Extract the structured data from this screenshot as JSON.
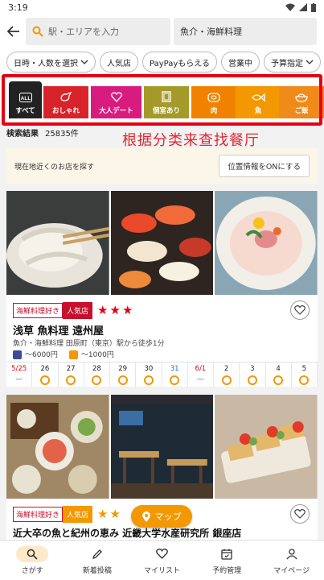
{
  "status": {
    "time": "3:19"
  },
  "search": {
    "area_placeholder": "駅・エリアを入力",
    "genre_value": "魚介・海鮮料理"
  },
  "filters": [
    {
      "label": "日時・人数を選択",
      "dropdown": true
    },
    {
      "label": "人気店",
      "dropdown": false
    },
    {
      "label": "PayPayもらえる",
      "dropdown": false
    },
    {
      "label": "営業中",
      "dropdown": false
    },
    {
      "label": "予算指定",
      "dropdown": true
    }
  ],
  "categories": [
    {
      "label": "すべて",
      "icon": "all-icon",
      "color": "#222222"
    },
    {
      "label": "おしゃれ",
      "icon": "bird-icon",
      "color": "#d8232a"
    },
    {
      "label": "大人デート",
      "icon": "heart-icon",
      "color": "#d81b7f"
    },
    {
      "label": "個室あり",
      "icon": "door-icon",
      "color": "#a49a2a"
    },
    {
      "label": "肉",
      "icon": "meat-icon",
      "color": "#f08200"
    },
    {
      "label": "魚",
      "icon": "fish-icon",
      "color": "#f39800"
    },
    {
      "label": "ご飯",
      "icon": "rice-bowl-icon",
      "color": "#f08a1b"
    }
  ],
  "results": {
    "label": "検索結果",
    "count": "25835件"
  },
  "annotation": "根据分类来查找餐厅",
  "location": {
    "text": "現在地近くのお店を探す",
    "button": "位置情報をONにする"
  },
  "restaurants": [
    {
      "badge_genre": "海鮮料理好き",
      "badge_popular": "人気店",
      "stars": 3,
      "name": "浅草 魚料理 遠州屋",
      "info": "魚介・海鮮料理 田原町（東京）駅から徒歩1分",
      "dinner_price": "～6000円",
      "lunch_price": "～1000円",
      "calendar": [
        {
          "date": "5/25",
          "avail": "dash",
          "color": "#e60012"
        },
        {
          "date": "26",
          "avail": "ring",
          "color": "#222222"
        },
        {
          "date": "27",
          "avail": "ring",
          "color": "#222222"
        },
        {
          "date": "28",
          "avail": "ring",
          "color": "#222222"
        },
        {
          "date": "29",
          "avail": "ring",
          "color": "#222222"
        },
        {
          "date": "30",
          "avail": "ring",
          "color": "#222222"
        },
        {
          "date": "31",
          "avail": "ring",
          "color": "#1e6fd9"
        },
        {
          "date": "6/1",
          "avail": "dash",
          "color": "#e60012"
        },
        {
          "date": "2",
          "avail": "ring",
          "color": "#222222"
        },
        {
          "date": "3",
          "avail": "ring",
          "color": "#222222"
        },
        {
          "date": "4",
          "avail": "ring",
          "color": "#222222"
        },
        {
          "date": "5",
          "avail": "ring",
          "color": "#222222"
        }
      ]
    },
    {
      "badge_genre": "海鮮料理好き",
      "badge_popular": "人気店",
      "stars": 2,
      "name": "近大卒の魚と紀州の恵み 近畿大学水産研究所 銀座店"
    }
  ],
  "map_button": "マップ",
  "tabs": [
    {
      "label": "さがす",
      "icon": "search-icon",
      "active": true
    },
    {
      "label": "新着投稿",
      "icon": "pen-icon",
      "active": false
    },
    {
      "label": "マイリスト",
      "icon": "heart-icon",
      "active": false
    },
    {
      "label": "予約管理",
      "icon": "calendar-icon",
      "active": false
    },
    {
      "label": "マイページ",
      "icon": "person-icon",
      "active": false
    }
  ]
}
